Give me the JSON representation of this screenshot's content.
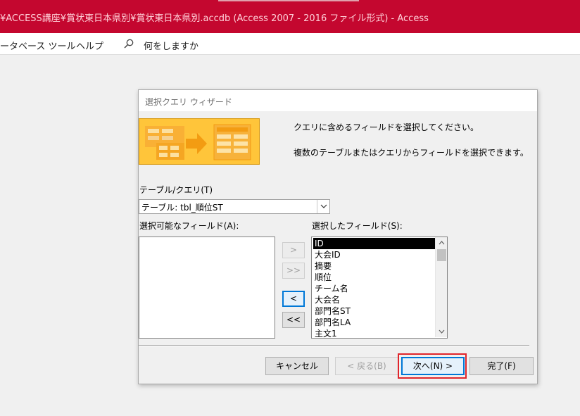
{
  "window": {
    "title": "¥ACCESS講座¥賞状東日本県別¥賞状東日本県別.accdb (Access 2007 - 2016 ファイル形式)  -  Access"
  },
  "ribbon": {
    "tabs": [
      "ータベース ツール",
      "ヘルプ"
    ],
    "search_label": "何をしますか"
  },
  "dialog": {
    "title": "選択クエリ ウィザード",
    "instruction_1": "クエリに含めるフィールドを選択してください。",
    "instruction_2": "複数のテーブルまたはクエリからフィールドを選択できます。",
    "table_query_label": "テーブル/クエリ(T)",
    "table_query_value": "テーブル: tbl_順位ST",
    "available_fields_label": "選択可能なフィールド(A):",
    "selected_fields_label": "選択したフィールド(S):",
    "available_fields": [],
    "selected_fields": [
      "ID",
      "大会ID",
      "摘要",
      "順位",
      "チーム名",
      "大会名",
      "部門名ST",
      "部門名LA",
      "主文1"
    ],
    "selected_index": 0,
    "move_buttons": {
      "add_one": ">",
      "add_all": ">>",
      "remove_one": "<",
      "remove_all": "<<"
    },
    "buttons": {
      "cancel": "キャンセル",
      "back": "< 戻る(B)",
      "next": "次へ(N) >",
      "finish": "完了(F)"
    }
  },
  "colors": {
    "titlebar": "#c4072f",
    "focus": "#0078d7",
    "highlight_annotation": "#e0252b",
    "graphic": "#ffc53a"
  }
}
